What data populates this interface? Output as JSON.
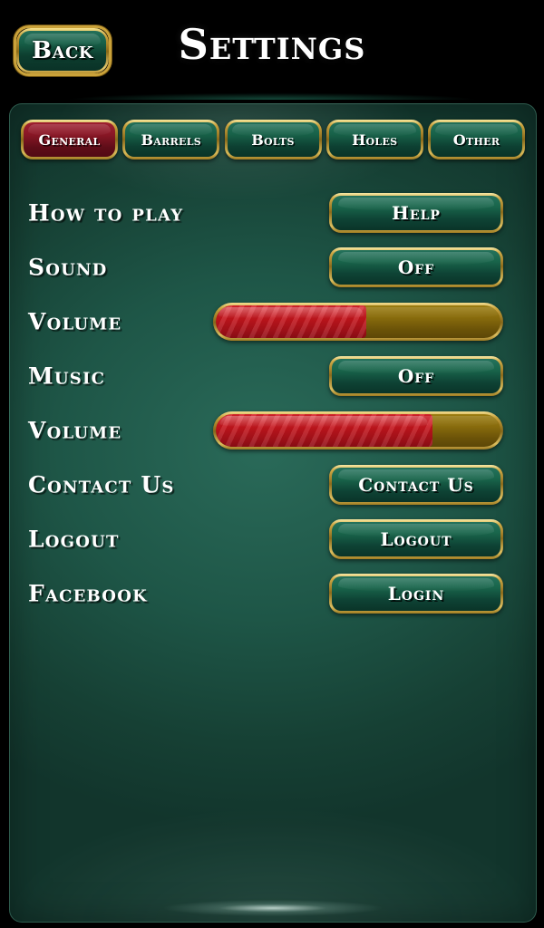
{
  "header": {
    "back_label": "Back",
    "title": "Settings"
  },
  "tabs": [
    {
      "label": "General",
      "active": true
    },
    {
      "label": "Barrels",
      "active": false
    },
    {
      "label": "Bolts",
      "active": false
    },
    {
      "label": "Holes",
      "active": false
    },
    {
      "label": "Other",
      "active": false
    }
  ],
  "rows": [
    {
      "label": "How to play",
      "control": "button",
      "value": "Help"
    },
    {
      "label": "Sound",
      "control": "button",
      "value": "Off"
    },
    {
      "label": "Volume",
      "control": "slider",
      "percent": 53
    },
    {
      "label": "Music",
      "control": "button",
      "value": "Off"
    },
    {
      "label": "Volume",
      "control": "slider",
      "percent": 76
    },
    {
      "label": "Contact Us",
      "control": "button",
      "value": "Contact Us"
    },
    {
      "label": "Logout",
      "control": "button",
      "value": "Logout"
    },
    {
      "label": "Facebook",
      "control": "button",
      "value": "Login"
    }
  ],
  "colors": {
    "header_bg": "#000000",
    "panel_green": "#1e5647",
    "gold": "#caa33f",
    "active_tab_red": "#8a1726",
    "slider_fill_red": "#c5151d",
    "slider_track_gold": "#8a6d0d",
    "text_white": "#ffffff"
  }
}
